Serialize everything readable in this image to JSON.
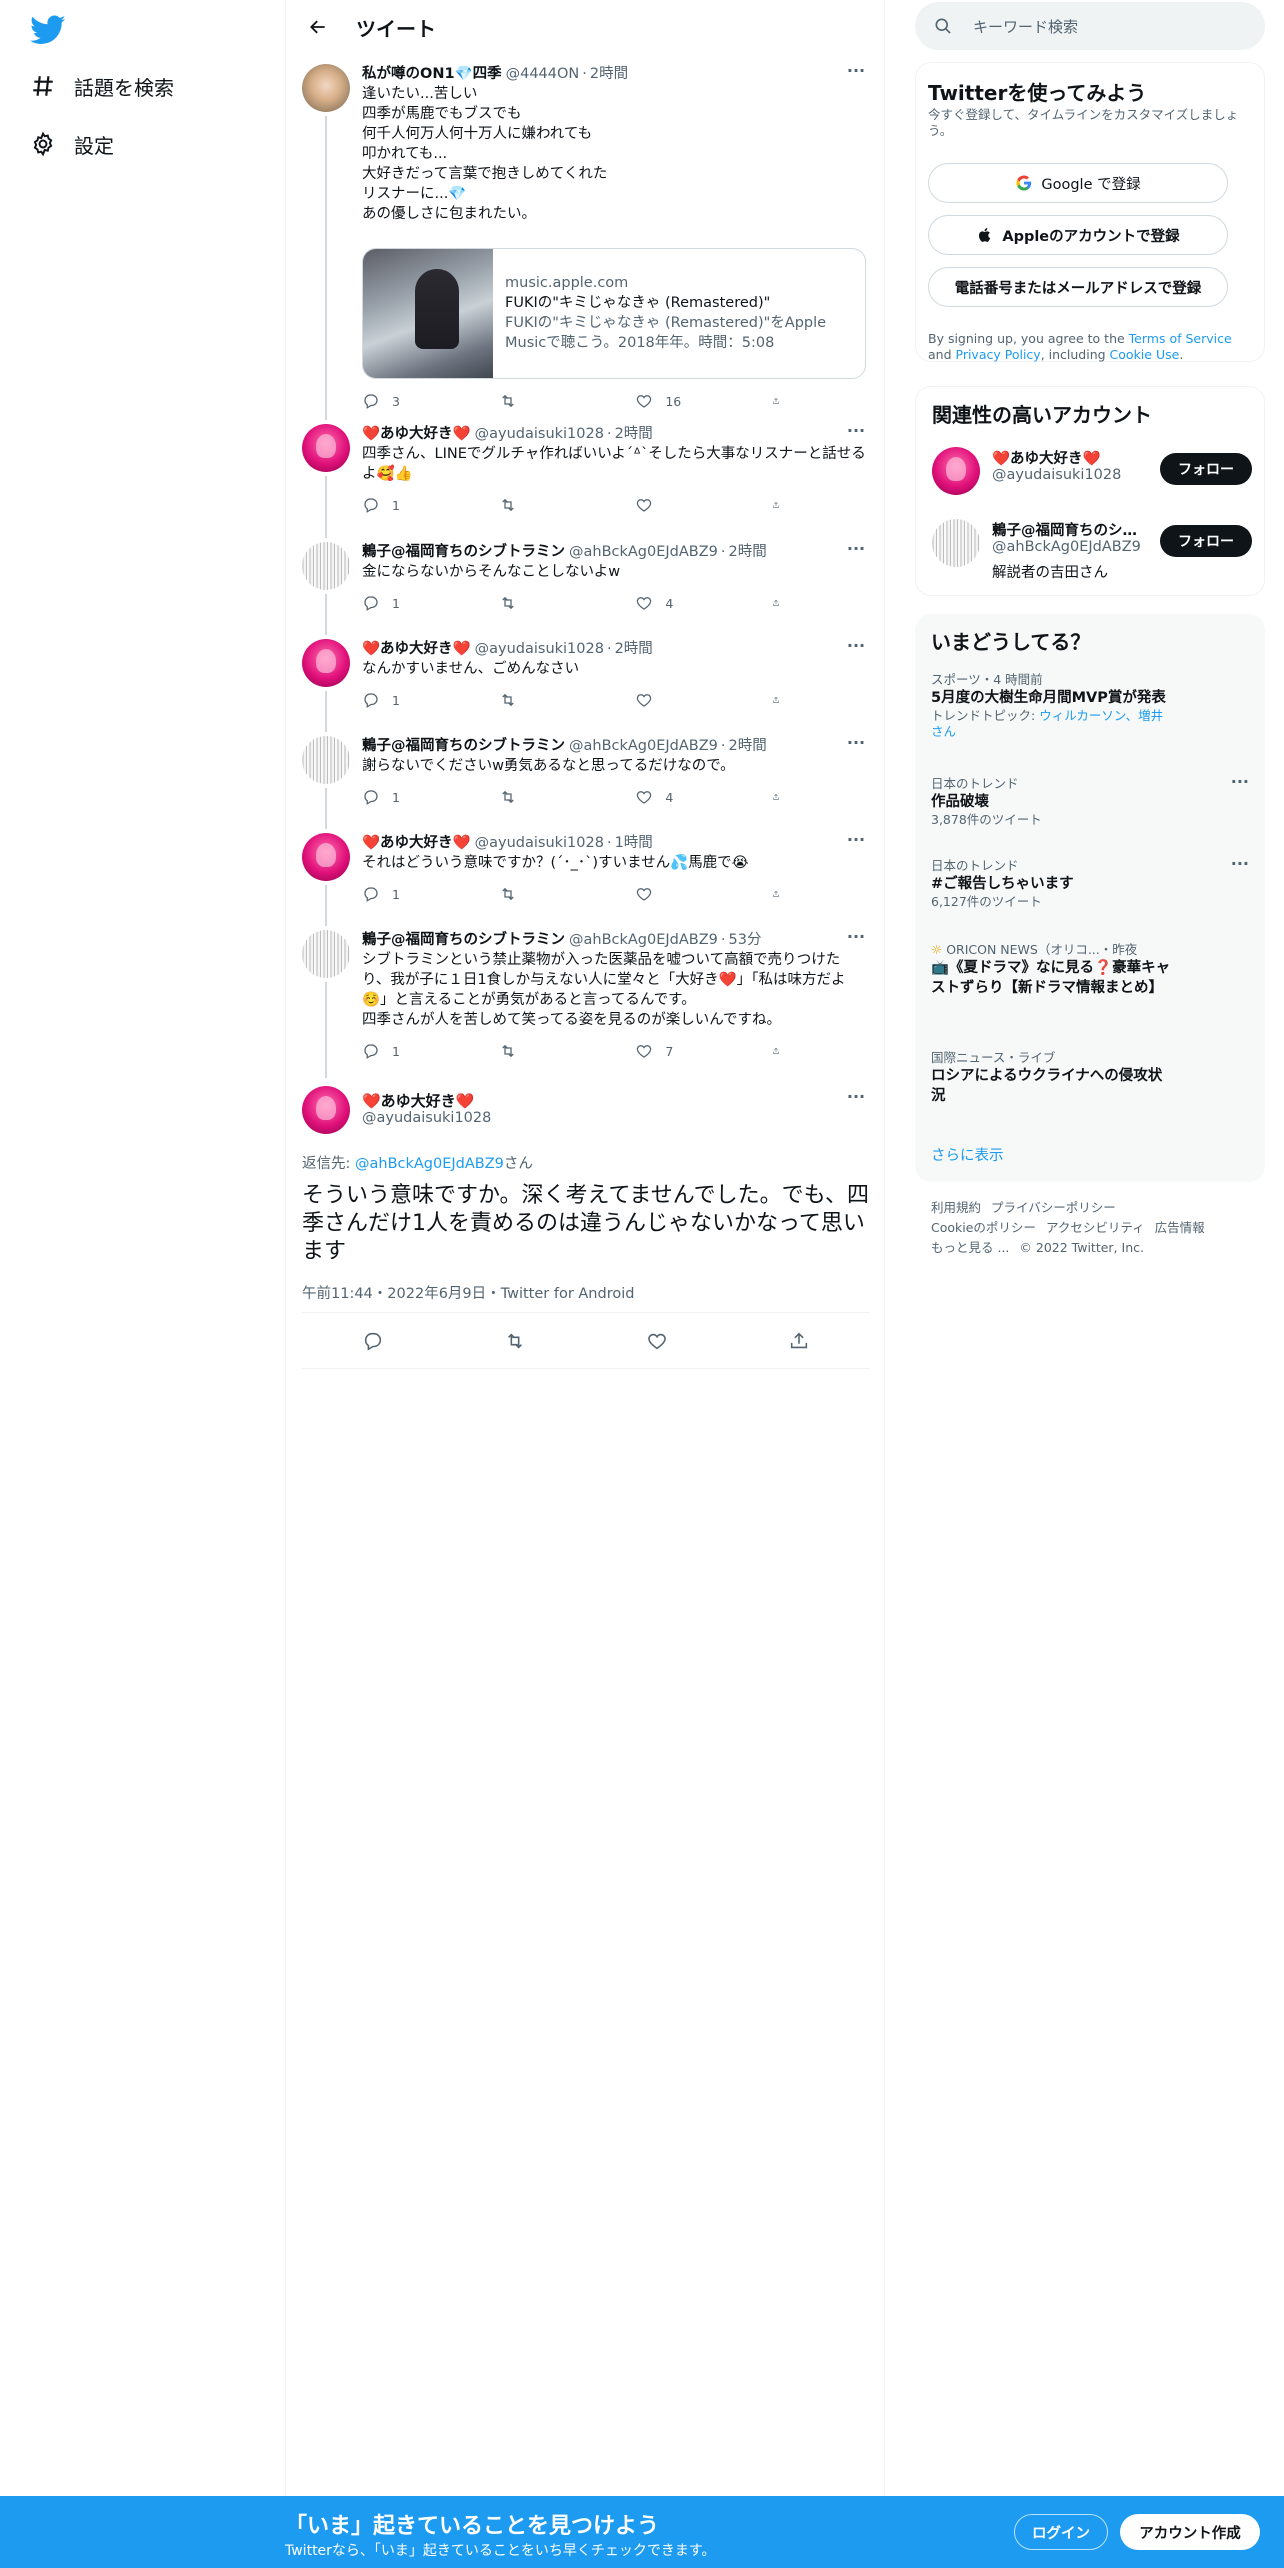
{
  "nav": {
    "explore_label": "話題を検索",
    "settings_label": "設定"
  },
  "header": {
    "title": "ツイート"
  },
  "thread": [
    {
      "name": "私が噂のON1💎四季",
      "handle": "@4444ON",
      "time": "2時間",
      "text": "逢いたい...苦しい\n四季が馬鹿でもブスでも\n何千人何万人何十万人に嫌われても\n叩かれても...\n大好きだって言葉で抱きしめてくれた\nリスナーに...💎\nあの優しさに包まれたい。",
      "replies": "3",
      "retweets": "",
      "likes": "16"
    },
    {
      "name": "❤️あゆ大好き❤️",
      "handle": "@ayudaisuki1028",
      "time": "2時間",
      "text": "四季さん、LINEでグルチャ作ればいいよ´ᐞ`そしたら大事なリスナーと話せるよ🥰👍",
      "replies": "1",
      "retweets": "",
      "likes": ""
    },
    {
      "name": "鶫子@福岡育ちのシブトラミン",
      "handle": "@ahBckAg0EJdABZ9",
      "time": "2時間",
      "text": "金にならないからそんなことしないよw",
      "replies": "1",
      "retweets": "",
      "likes": "4"
    },
    {
      "name": "❤️あゆ大好き❤️",
      "handle": "@ayudaisuki1028",
      "time": "2時間",
      "text": "なんかすいません、ごめんなさい",
      "replies": "1",
      "retweets": "",
      "likes": ""
    },
    {
      "name": "鶫子@福岡育ちのシブトラミン",
      "handle": "@ahBckAg0EJdABZ9",
      "time": "2時間",
      "text": "謝らないでくださいw勇気あるなと思ってるだけなので。",
      "replies": "1",
      "retweets": "",
      "likes": "4"
    },
    {
      "name": "❤️あゆ大好き❤️",
      "handle": "@ayudaisuki1028",
      "time": "1時間",
      "text": "それはどういう意味ですか？(´･_･`)すいません💦馬鹿で😭",
      "replies": "1",
      "retweets": "",
      "likes": ""
    },
    {
      "name": "鶫子@福岡育ちのシブトラミン",
      "handle": "@ahBckAg0EJdABZ9",
      "time": "53分",
      "text": "シブトラミンという禁止薬物が入った医薬品を嘘ついて高額で売りつけたり、我が子に１日1食しか与えない人に堂々と「大好き❤️」「私は味方だよ☺️」と言えることが勇気があると言ってるんです。\n四季さんが人を苦しめて笑ってる姿を見るのが楽しいんですね。",
      "replies": "1",
      "retweets": "",
      "likes": "7"
    }
  ],
  "card": {
    "domain": "music.apple.com",
    "title": "FUKIの\"キミじゃなきゃ (Remastered)\"",
    "desc": "FUKIの\"キミじゃなきゃ (Remastered)\"をApple Musicで聴こう。2018年年。時間：5:08"
  },
  "focus": {
    "name": "❤️あゆ大好き❤️",
    "handle": "@ayudaisuki1028",
    "reply_prefix": "返信先: ",
    "reply_mention": "@ahBckAg0EJdABZ9",
    "reply_suffix": "さん",
    "text": "そういう意味ですか。深く考えてませんでした。でも、四季さんだけ1人を責めるのは違うんじゃないかなって思います",
    "meta": "午前11:44・2022年6月9日・Twitter for Android"
  },
  "search": {
    "placeholder": "キーワード検索"
  },
  "signup": {
    "title": "Twitterを使ってみよう",
    "subtitle": "今すぐ登録して、タイムラインをカスタマイズしましょう。",
    "google_label": "Google で登録",
    "apple_label": "Appleのアカウントで登録",
    "phone_label": "電話番号またはメールアドレスで登録",
    "legal_pre": "By signing up, you agree to the ",
    "legal_terms": "Terms of Service",
    "legal_and": " and ",
    "legal_privacy": "Privacy Policy",
    "legal_mid": ", including ",
    "legal_cookie": "Cookie Use",
    "legal_end": "."
  },
  "related": {
    "title": "関連性の高いアカウント",
    "follow_label": "フォロー",
    "accounts": [
      {
        "name": "❤️あゆ大好き❤️",
        "handle": "@ayudaisuki1028",
        "bio": ""
      },
      {
        "name": "鶫子@福岡育ちのシブトラミン",
        "handle": "@ahBckAg0EJdABZ9",
        "bio": "解説者の吉田さん"
      }
    ]
  },
  "trends": {
    "title": "いまどうしてる？",
    "items": [
      {
        "meta": "スポーツ・4 時間前",
        "title": "5月度の大樹生命月間MVP賞が発表",
        "sub_pre": "トレンドトピック: ",
        "sub_link": "ウィルカーソン、増井さん",
        "count": ""
      },
      {
        "meta": "日本のトレンド",
        "title": "作品破壊",
        "count": "3,878件のツイート"
      },
      {
        "meta": "日本のトレンド",
        "title": "#ご報告しちゃいます",
        "count": "6,127件のツイート"
      },
      {
        "meta": "ORICON NEWS（オリコ...・昨夜",
        "title": "📺《夏ドラマ》なに見る❓豪華キャストずらり【新ドラマ情報まとめ】",
        "count": ""
      },
      {
        "meta": "国際ニュース・ライブ",
        "title": "ロシアによるウクライナへの侵攻状況",
        "count": ""
      }
    ],
    "show_more": "さらに表示"
  },
  "footer": {
    "terms": "利用規約",
    "privacy": "プライバシーポリシー",
    "cookie": "Cookieのポリシー",
    "access": "アクセシビリティ",
    "ads": "広告情報",
    "more": "もっと見る ...",
    "copyright": "© 2022 Twitter, Inc."
  },
  "bottombar": {
    "title": "「いま」起きていることを見つけよう",
    "subtitle": "Twitterなら、「いま」起きていることをいち早くチェックできます。",
    "login": "ログイン",
    "signup": "アカウント作成"
  },
  "colors": {
    "accent": "#1d9bf0",
    "text": "#0f1419",
    "muted": "#536471",
    "border": "#cfd9de"
  }
}
